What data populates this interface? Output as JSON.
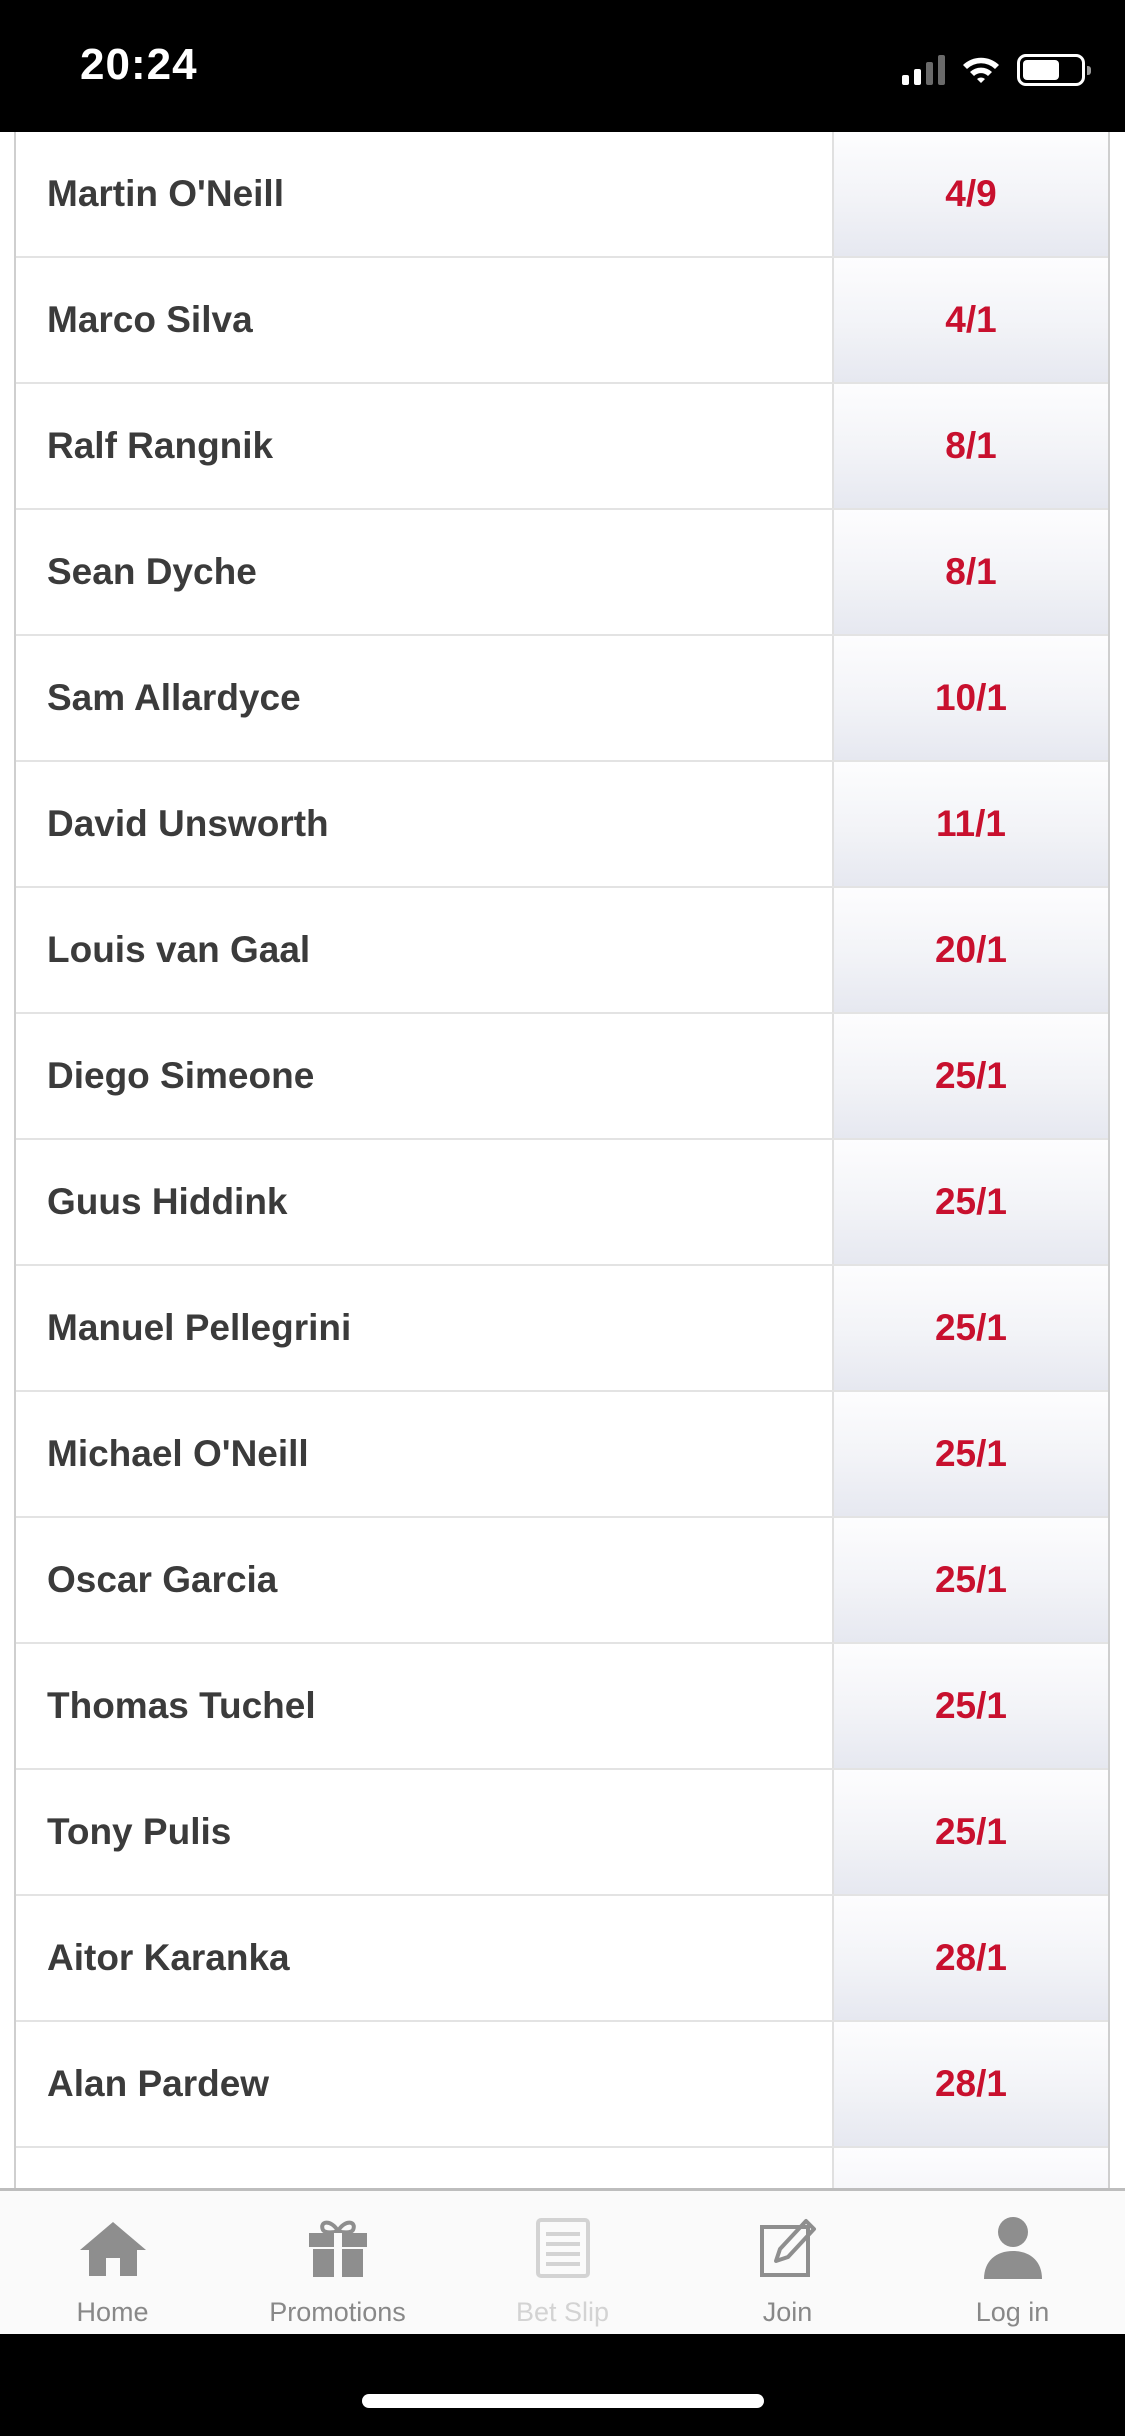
{
  "status_bar": {
    "time": "20:24"
  },
  "market": {
    "selections": [
      {
        "name": "Martin O'Neill",
        "odds": "4/9"
      },
      {
        "name": "Marco Silva",
        "odds": "4/1"
      },
      {
        "name": "Ralf Rangnik",
        "odds": "8/1"
      },
      {
        "name": "Sean Dyche",
        "odds": "8/1"
      },
      {
        "name": "Sam Allardyce",
        "odds": "10/1"
      },
      {
        "name": "David Unsworth",
        "odds": "11/1"
      },
      {
        "name": "Louis van Gaal",
        "odds": "20/1"
      },
      {
        "name": "Diego Simeone",
        "odds": "25/1"
      },
      {
        "name": "Guus Hiddink",
        "odds": "25/1"
      },
      {
        "name": "Manuel Pellegrini",
        "odds": "25/1"
      },
      {
        "name": "Michael O'Neill",
        "odds": "25/1"
      },
      {
        "name": "Oscar Garcia",
        "odds": "25/1"
      },
      {
        "name": "Thomas Tuchel",
        "odds": "25/1"
      },
      {
        "name": "Tony Pulis",
        "odds": "25/1"
      },
      {
        "name": "Aitor Karanka",
        "odds": "28/1"
      },
      {
        "name": "Alan Pardew",
        "odds": "28/1"
      }
    ]
  },
  "tab_bar": {
    "home": {
      "label": "Home",
      "icon": "home-icon"
    },
    "promotions": {
      "label": "Promotions",
      "icon": "gift-icon"
    },
    "bet_slip": {
      "label": "Bet Slip",
      "icon": "bet-slip-icon"
    },
    "join": {
      "label": "Join",
      "icon": "join-icon"
    },
    "login": {
      "label": "Log in",
      "icon": "user-icon"
    }
  },
  "colors": {
    "odds_text": "#c8102e",
    "name_text": "#3b3b3b",
    "tab_icon": "#8e8e8e"
  }
}
